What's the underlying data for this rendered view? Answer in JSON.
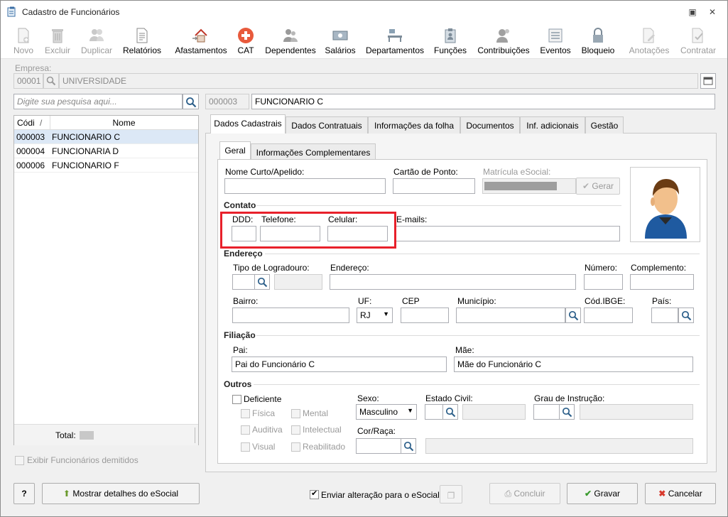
{
  "window": {
    "title": "Cadastro de Funcionários"
  },
  "toolbar": [
    {
      "label": "Novo",
      "icon": "new-icon",
      "enabled": false
    },
    {
      "label": "Excluir",
      "icon": "trash-icon",
      "enabled": false
    },
    {
      "label": "Duplicar",
      "icon": "duplicate-icon",
      "enabled": false
    },
    {
      "label": "Relatórios",
      "icon": "report-icon",
      "enabled": true
    },
    {
      "label": "Afastamentos",
      "icon": "house-icon",
      "enabled": true
    },
    {
      "label": "CAT",
      "icon": "medical-cross-icon",
      "enabled": true
    },
    {
      "label": "Dependentes",
      "icon": "people-icon",
      "enabled": true
    },
    {
      "label": "Salários",
      "icon": "money-icon",
      "enabled": true
    },
    {
      "label": "Departamentos",
      "icon": "desk-icon",
      "enabled": true
    },
    {
      "label": "Funções",
      "icon": "badge-icon",
      "enabled": true
    },
    {
      "label": "Contribuições",
      "icon": "contributions-icon",
      "enabled": true
    },
    {
      "label": "Eventos",
      "icon": "list-icon",
      "enabled": true
    },
    {
      "label": "Bloqueio",
      "icon": "lock-icon",
      "enabled": true
    },
    {
      "label": "Anotações",
      "icon": "edit-icon",
      "enabled": false
    },
    {
      "label": "Contratar",
      "icon": "hire-icon",
      "enabled": false
    }
  ],
  "empresa": {
    "label": "Empresa:",
    "code": "00001",
    "name": "UNIVERSIDADE"
  },
  "search": {
    "placeholder": "Digite sua pesquisa aqui..."
  },
  "current": {
    "code": "000003",
    "name": "FUNCIONARIO C"
  },
  "grid": {
    "col_code": "Códi",
    "col_name": "Nome",
    "rows": [
      {
        "code": "000003",
        "name": "FUNCIONARIO C"
      },
      {
        "code": "000004",
        "name": "FUNCIONARIA D"
      },
      {
        "code": "000006",
        "name": "FUNCIONARIO F"
      }
    ],
    "total_label": "Total:"
  },
  "show_dismissed": "Exibir Funcionários demitidos",
  "tabs": [
    "Dados Cadastrais",
    "Dados Contratuais",
    "Informações da folha",
    "Documentos",
    "Inf. adicionais",
    "Gestão"
  ],
  "subtabs": [
    "Geral",
    "Informações Complementares"
  ],
  "form": {
    "nome_curto": "Nome Curto/Apelido:",
    "cartao": "Cartão de Ponto:",
    "matricula": "Matrícula eSocial:",
    "gerar": "Gerar",
    "contato": "Contato",
    "ddd": "DDD:",
    "telefone": "Telefone:",
    "celular": "Celular:",
    "emails": "E-mails:",
    "endereco_sec": "Endereço",
    "tipo_log": "Tipo de Logradouro:",
    "endereco": "Endereço:",
    "numero": "Número:",
    "complemento": "Complemento:",
    "bairro": "Bairro:",
    "uf": "UF:",
    "uf_value": "RJ",
    "cep": "CEP",
    "municipio": "Município:",
    "cod_ibge": "Cód.IBGE:",
    "pais": "País:",
    "filiacao": "Filiação",
    "pai": "Pai:",
    "pai_value": "Pai do Funcionário C",
    "mae": "Mãe:",
    "mae_value": "Mãe do Funcionário C",
    "outros": "Outros",
    "deficiente": "Deficiente",
    "fisica": "Física",
    "mental": "Mental",
    "auditiva": "Auditiva",
    "intelectual": "Intelectual",
    "visual": "Visual",
    "reabilitado": "Reabilitado",
    "sexo": "Sexo:",
    "sexo_value": "Masculino",
    "estado_civil": "Estado Civil:",
    "grau": "Grau de Instrução:",
    "cor": "Cor/Raça:"
  },
  "footer": {
    "help": "?",
    "esocial_details": "Mostrar detalhes do eSocial",
    "send_alteration": "Enviar alteração para o eSocial",
    "concluir": "Concluir",
    "gravar": "Gravar",
    "cancelar": "Cancelar"
  },
  "colors": {
    "highlight": "#e8202a",
    "selected_row": "#dce8f6"
  }
}
